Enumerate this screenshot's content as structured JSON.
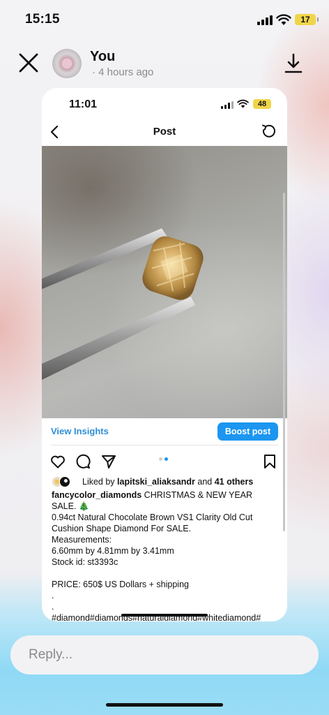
{
  "status_bar": {
    "time": "15:15",
    "battery": "17"
  },
  "story": {
    "user_name": "You",
    "post_time": "· 4 hours ago"
  },
  "screenshot": {
    "status_time": "11:01",
    "battery": "48",
    "nav_title": "Post",
    "view_insights": "View Insights",
    "boost_post": "Boost post",
    "likes": {
      "prefix": "Liked by ",
      "user": "lapitski_aliaksandr",
      "middle": " and ",
      "others": "41 others"
    },
    "caption": {
      "handle": "fancycolor_diamonds",
      "first_line": " CHRISTMAS & NEW YEAR SALE. 🎄",
      "body": "0.94ct Natural Chocolate Brown VS1 Clarity Old Cut Cushion Shape Diamond For SALE.\nMeasurements:\n6.60mm by 4.81mm by 3.41mm\nStock id: st3393c\n\nPRICE: 650$ US Dollars + shipping\n.\n.\n#diamond#diamonds#naturaldiamond#whitediamond#"
    }
  },
  "reply": {
    "placeholder": "Reply..."
  }
}
